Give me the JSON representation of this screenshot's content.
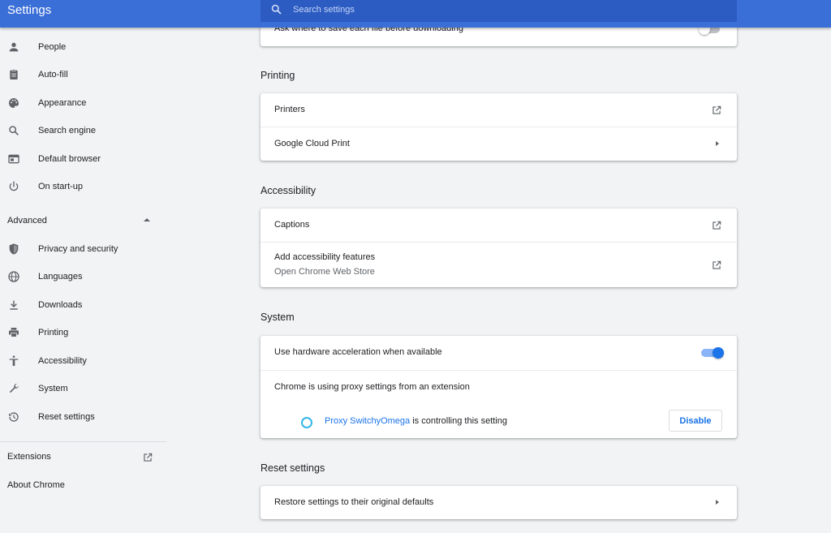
{
  "header": {
    "title": "Settings",
    "search_placeholder": "Search settings"
  },
  "sidebar": {
    "items": [
      {
        "label": "People",
        "icon": "person-icon"
      },
      {
        "label": "Auto-fill",
        "icon": "clipboard-icon"
      },
      {
        "label": "Appearance",
        "icon": "palette-icon"
      },
      {
        "label": "Search engine",
        "icon": "search-icon"
      },
      {
        "label": "Default browser",
        "icon": "browser-icon"
      },
      {
        "label": "On start-up",
        "icon": "power-icon"
      }
    ],
    "advanced_label": "Advanced",
    "advanced_items": [
      {
        "label": "Privacy and security",
        "icon": "shield-icon"
      },
      {
        "label": "Languages",
        "icon": "globe-icon"
      },
      {
        "label": "Downloads",
        "icon": "download-icon"
      },
      {
        "label": "Printing",
        "icon": "printer-icon"
      },
      {
        "label": "Accessibility",
        "icon": "accessibility-icon"
      },
      {
        "label": "System",
        "icon": "wrench-icon"
      },
      {
        "label": "Reset settings",
        "icon": "history-icon"
      }
    ],
    "extensions_label": "Extensions",
    "about_label": "About Chrome"
  },
  "downloads_card": {
    "ask_label": "Ask where to save each file before downloading",
    "ask_enabled": false
  },
  "printing": {
    "title": "Printing",
    "printers_label": "Printers",
    "cloud_print_label": "Google Cloud Print"
  },
  "accessibility": {
    "title": "Accessibility",
    "captions_label": "Captions",
    "add_features_label": "Add accessibility features",
    "add_features_sub": "Open Chrome Web Store"
  },
  "system": {
    "title": "System",
    "hw_accel_label": "Use hardware acceleration when available",
    "hw_accel_enabled": true,
    "proxy_label": "Chrome is using proxy settings from an extension",
    "proxy_ext_name": "Proxy SwitchyOmega",
    "proxy_controlling_text": " is controlling this setting",
    "disable_label": "Disable"
  },
  "reset": {
    "title": "Reset settings",
    "restore_label": "Restore settings to their original defaults"
  },
  "colors": {
    "header": "#3b6fd8",
    "search_bg": "#2c5bc2",
    "accent": "#1a73e8",
    "proxy_ring": "#33b6e8"
  }
}
